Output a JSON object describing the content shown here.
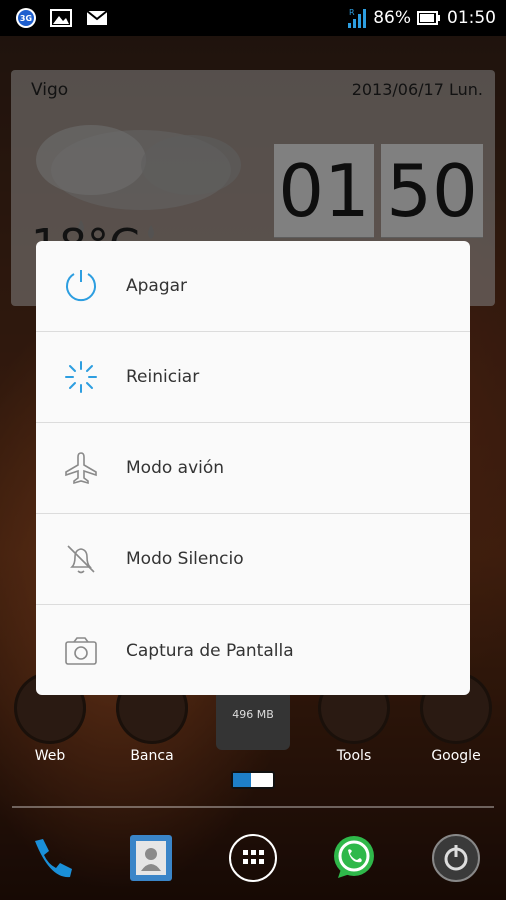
{
  "status_bar": {
    "left_icons": [
      "3g-icon",
      "gallery-icon",
      "gmail-icon"
    ],
    "network_badge": "3G",
    "signal_badge": "R",
    "battery": "86%",
    "time": "01:50"
  },
  "widget": {
    "city": "Vigo",
    "date": "2013/06/17  Lun.",
    "hour": "01",
    "minute": "50",
    "temp_partial": "18°C"
  },
  "dialog": {
    "items": [
      {
        "label": "Apagar",
        "icon": "power-icon"
      },
      {
        "label": "Reiniciar",
        "icon": "restart-icon"
      },
      {
        "label": "Modo avión",
        "icon": "airplane-icon"
      },
      {
        "label": "Modo Silencio",
        "icon": "silent-bell-icon"
      },
      {
        "label": "Captura de Pantalla",
        "icon": "camera-icon"
      }
    ]
  },
  "home_apps": [
    {
      "label": "Web"
    },
    {
      "label": "Banca"
    },
    {
      "label": "Tools"
    },
    {
      "label": "Google"
    }
  ],
  "memory_widget": {
    "label": "496 MB",
    "progress": 0.45
  },
  "dock": [
    {
      "name": "phone-icon"
    },
    {
      "name": "contacts-icon"
    },
    {
      "name": "app-drawer-icon"
    },
    {
      "name": "whatsapp-icon"
    },
    {
      "name": "power-widget-icon"
    }
  ],
  "colors": {
    "accent_blue": "#2d9ee0",
    "icon_gray": "#8a8a8a",
    "dialog_bg": "#fafafa"
  }
}
